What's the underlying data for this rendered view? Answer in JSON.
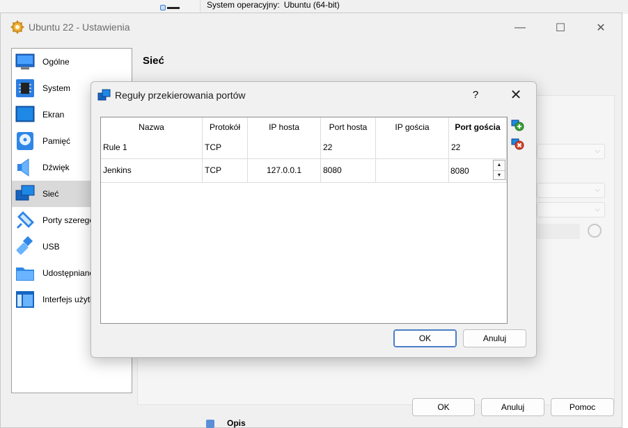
{
  "background": {
    "os_label": "System operacyjny:",
    "os_value": "Ubuntu (64-bit)",
    "peek_label": "Opis"
  },
  "window": {
    "title": "Ubuntu 22 - Ustawienia",
    "controls": {
      "minimize": "—",
      "maximize": "☐",
      "close": "✕"
    }
  },
  "sidebar": {
    "items": [
      {
        "label": "Ogólne",
        "icon": "monitor-general-icon"
      },
      {
        "label": "System",
        "icon": "chip-icon"
      },
      {
        "label": "Ekran",
        "icon": "display-icon"
      },
      {
        "label": "Pamięć",
        "icon": "disk-icon"
      },
      {
        "label": "Dźwięk",
        "icon": "speaker-icon"
      },
      {
        "label": "Sieć",
        "icon": "network-icon",
        "selected": true
      },
      {
        "label": "Porty szeregowe",
        "icon": "serial-port-icon"
      },
      {
        "label": "USB",
        "icon": "usb-icon"
      },
      {
        "label": "Udostępniane foldery",
        "icon": "folder-icon"
      },
      {
        "label": "Interfejs użytkownika",
        "icon": "ui-icon"
      }
    ]
  },
  "pane": {
    "title": "Sieć"
  },
  "footer": {
    "ok": "OK",
    "cancel": "Anuluj",
    "help": "Pomoc"
  },
  "dialog": {
    "title": "Reguły przekierowania portów",
    "help": "?",
    "close": "✕",
    "columns": [
      "Nazwa",
      "Protokół",
      "IP hosta",
      "Port hosta",
      "IP gościa",
      "Port gościa"
    ],
    "rows": [
      {
        "name": "Rule 1",
        "protocol": "TCP",
        "host_ip": "",
        "host_port": "22",
        "guest_ip": "",
        "guest_port": "22"
      },
      {
        "name": "Jenkins",
        "protocol": "TCP",
        "host_ip": "127.0.0.1",
        "host_port": "8080",
        "guest_ip": "",
        "guest_port": "8080"
      }
    ],
    "add_icon": "add-rule-icon",
    "remove_icon": "remove-rule-icon",
    "ok": "OK",
    "cancel": "Anuluj",
    "colors": {
      "accent": "#4a7ec8",
      "add": "#3aa33a",
      "remove": "#d9452b"
    }
  }
}
